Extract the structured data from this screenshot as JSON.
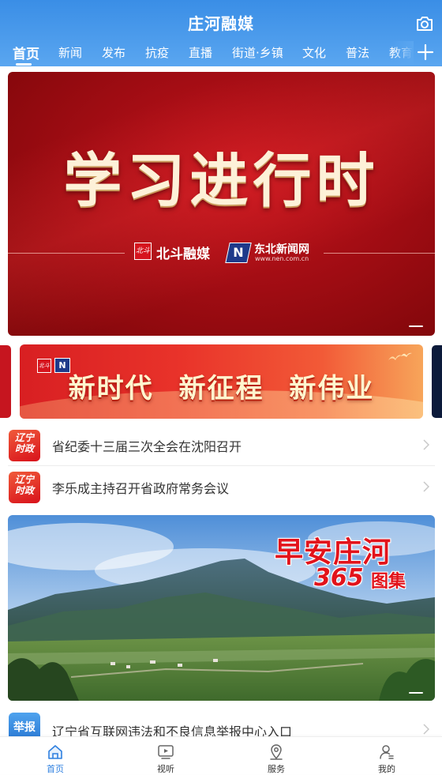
{
  "app": {
    "title": "庄河融媒"
  },
  "tabs": [
    {
      "label": "首页",
      "active": true
    },
    {
      "label": "新闻"
    },
    {
      "label": "发布"
    },
    {
      "label": "抗疫"
    },
    {
      "label": "直播"
    },
    {
      "label": "街道·乡镇"
    },
    {
      "label": "文化"
    },
    {
      "label": "普法"
    },
    {
      "label": "教育"
    }
  ],
  "hero": {
    "title": "学习进行时",
    "logo_badge": "北斗",
    "logo_beidou": "北斗融媒",
    "logo_nen_mark": "N",
    "logo_nen": "东北新闻网",
    "logo_nen_url": "www.nen.com.cn"
  },
  "banner2": {
    "logo_badge": "北斗",
    "logo_mark": "N",
    "text": "新时代 新征程 新伟业"
  },
  "news": [
    {
      "badge": "辽宁\n时政",
      "title": "省纪委十三届三次全会在沈阳召开"
    },
    {
      "badge": "辽宁\n时政",
      "title": "李乐成主持召开省政府常务会议"
    }
  ],
  "photo": {
    "caption_line1": "早安庄河",
    "caption_num": "365",
    "caption_suffix": "图集"
  },
  "report": {
    "badge": "举报",
    "title": "辽宁省互联网违法和不良信息举报中心入口"
  },
  "bottom_nav": [
    {
      "label": "首页",
      "icon": "home-icon",
      "active": true
    },
    {
      "label": "视听",
      "icon": "video-icon"
    },
    {
      "label": "服务",
      "icon": "location-icon"
    },
    {
      "label": "我的",
      "icon": "user-icon"
    }
  ],
  "colors": {
    "header": "#3a8ee6",
    "accent_red": "#d8121b",
    "nav_active": "#2f80e0"
  }
}
